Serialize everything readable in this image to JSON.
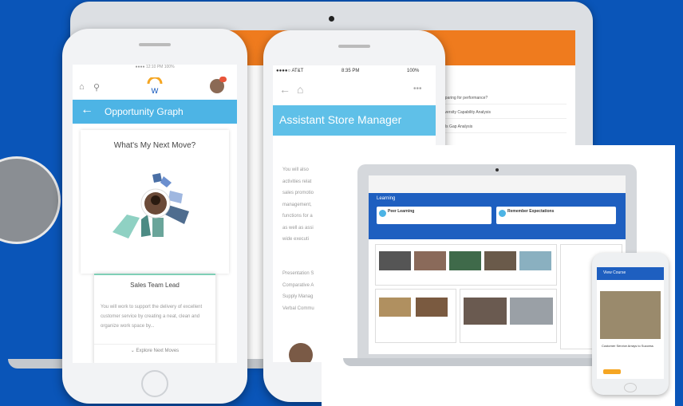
{
  "colors": {
    "background": "#0a55b8",
    "workday_blue": "#4db4e5",
    "workday_orange": "#ef7b1e",
    "learning_blue": "#1e5fc0"
  },
  "phone1": {
    "header_title": "Opportunity Graph",
    "question": "What's My Next Move?",
    "card_title": "Sales Team Lead",
    "card_desc": "You will work to support the delivery of excellent customer service by creating a neat, clean and organize work space by...",
    "explore_label": "Explore Next Moves",
    "icons": [
      "home-icon",
      "search-icon",
      "workday-logo-icon",
      "profile-avatar"
    ]
  },
  "phone2": {
    "carrier": "●●●●○ AT&T",
    "time": "8:35 PM",
    "battery": "100%",
    "job_title": "Assistant Store Manager",
    "body_lines": [
      "You will also",
      "activities relat",
      "sales promotio",
      "management,",
      "functions for a",
      "as well as assi",
      "wide executi"
    ],
    "body_lines2": [
      "Presentation S",
      "Comparative A",
      "Supply Manag",
      "Verbal Commu"
    ]
  },
  "back_laptop": {
    "rows": [
      "Preparing for performance?",
      "University Capability Analysis",
      "Skills Gap Analysis"
    ]
  },
  "laptop2": {
    "header_title": "Learning",
    "pill_left": "Peer Learning",
    "pill_right": "Remember Expectations"
  },
  "phone3": {
    "title": "View Course",
    "course": "Customer Service Arrays to Success"
  }
}
